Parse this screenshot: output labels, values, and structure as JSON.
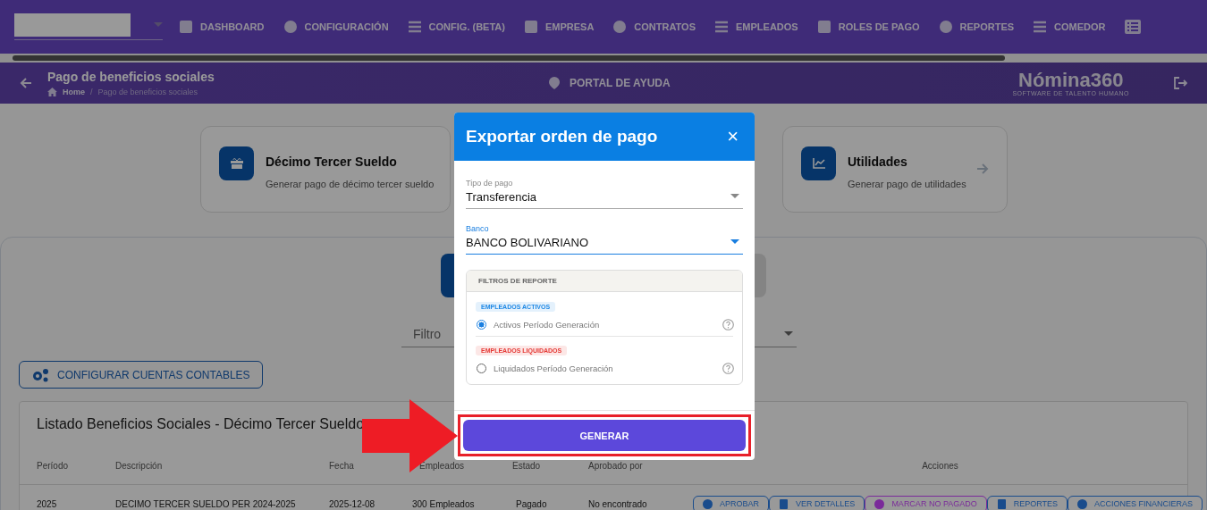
{
  "nav": {
    "items": [
      {
        "label": "DASHBOARD"
      },
      {
        "label": "CONFIGURACIÓN"
      },
      {
        "label": "CONFIG. (BETA)"
      },
      {
        "label": "EMPRESA"
      },
      {
        "label": "CONTRATOS"
      },
      {
        "label": "EMPLEADOS"
      },
      {
        "label": "ROLES DE PAGO"
      },
      {
        "label": "REPORTES"
      },
      {
        "label": "COMEDOR"
      }
    ]
  },
  "header": {
    "title": "Pago de beneficios sociales",
    "breadcrumb": [
      "Home",
      "Pago de beneficios sociales"
    ],
    "breadcrumb_separator": "/",
    "help": "PORTAL DE AYUDA",
    "logo": "Nómina360",
    "logo_tagline": "SOFTWARE DE TALENTO HUMANO"
  },
  "cards": [
    {
      "title": "Décimo Tercer Sueldo",
      "subtitle": "Generar pago de décimo tercer sueldo"
    },
    {
      "title": "Utilidades",
      "subtitle": "Generar pago de utilidades"
    }
  ],
  "filter": {
    "label": "Filtro"
  },
  "config_button": "CONFIGURAR CUENTAS CONTABLES",
  "table": {
    "title": "Listado Beneficios Sociales - Décimo Tercer Sueldo",
    "columns": [
      "Período",
      "Descripción",
      "Fecha",
      "Empleados",
      "Estado",
      "Aprobado por",
      "Acciones"
    ],
    "rows": [
      {
        "cells": [
          "2025",
          "DECIMO TERCER SUELDO PER 2024-2025",
          "2025-12-08",
          "300 Empleados",
          "Pagado",
          "No encontrado"
        ],
        "actions": [
          {
            "label": "APROBAR",
            "color": "#1a4c8c"
          },
          {
            "label": "VER DETALLES",
            "color": "#1a4c8c"
          },
          {
            "label": "MARCAR NO PAGADO",
            "color": "#7a2a9a"
          },
          {
            "label": "REPORTES",
            "color": "#1a4c8c"
          },
          {
            "label": "ACCIONES FINANCIERAS",
            "color": "#1a4c8c"
          }
        ]
      }
    ]
  },
  "dialog": {
    "title": "Exportar orden de pago",
    "close": "×",
    "fields": [
      {
        "label": "Tipo de pago",
        "value": "Transferencia",
        "focused": false
      },
      {
        "label": "Banco",
        "value": "BANCO BOLIVARIANO",
        "focused": true
      }
    ],
    "filters": {
      "title": "FILTROS DE REPORTE",
      "groups": [
        {
          "tag": "EMPLEADOS ACTIVOS",
          "color": "#1e88e5",
          "option": "Activos Período Generación",
          "selected": true
        },
        {
          "tag": "EMPLEADOS LIQUIDADOS",
          "color": "#e53935",
          "option": "Liquidados Período Generación",
          "selected": false
        }
      ]
    },
    "button": "GENERAR"
  }
}
